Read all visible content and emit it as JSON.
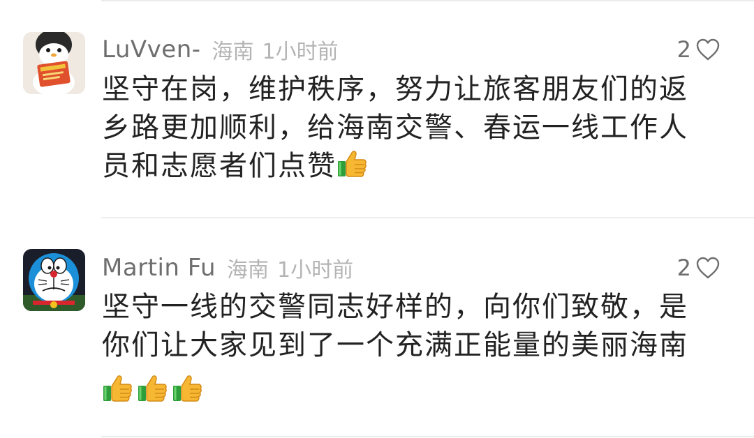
{
  "comments": [
    {
      "username": "LuVven-",
      "location": "海南",
      "time": "1小时前",
      "likes": "2",
      "text": "坚守在岗，维护秩序，努力让旅客朋友们的返乡路更加顺利，给海南交警、春运一线工作人员和志愿者们点赞",
      "emojis": [
        "thumbs-up-icon"
      ],
      "avatar": "penguin-reading-avatar"
    },
    {
      "username": "Martin Fu",
      "location": "海南",
      "time": "1小时前",
      "likes": "2",
      "text": "坚守一线的交警同志好样的，向你们致敬，是你们让大家见到了一个充满正能量的美丽海南",
      "emojis": [
        "thumbs-up-icon",
        "thumbs-up-icon",
        "thumbs-up-icon"
      ],
      "avatar": "doraemon-avatar"
    }
  ],
  "colors": {
    "username": "#6e6e6e",
    "meta": "#b4b4b4",
    "text": "#222222",
    "divider": "#ececec"
  }
}
